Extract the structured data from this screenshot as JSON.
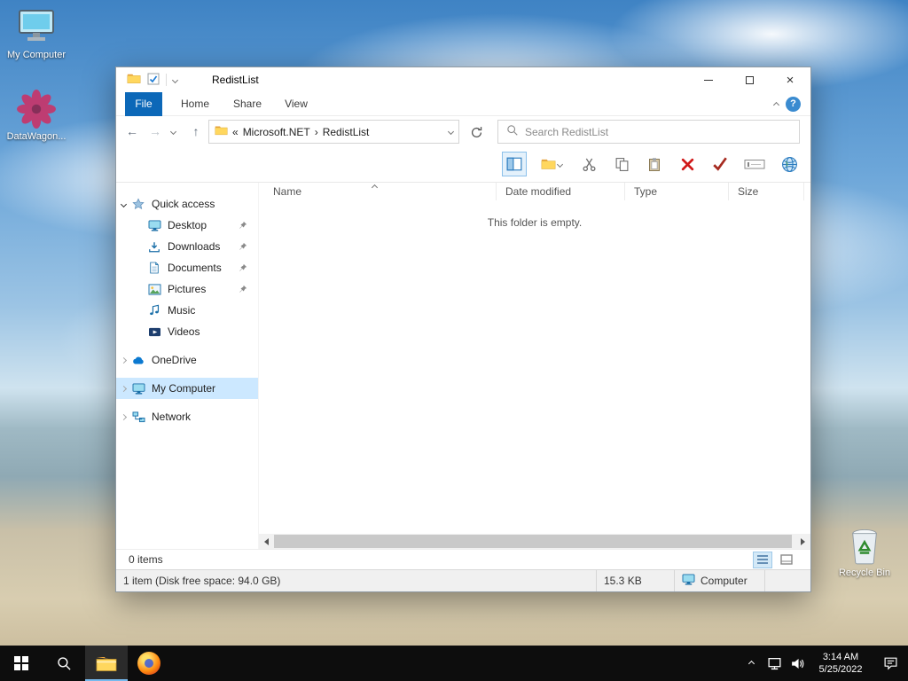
{
  "colors": {
    "accent_blue": "#0c68b8",
    "selection_blue": "#cce8ff",
    "delete_red": "#d01818",
    "taskbar_black": "#0d0d0d",
    "folder_yellow": "#ffd75e"
  },
  "desktop": {
    "my_computer_label": "My Computer",
    "datawagon_label": "DataWagon...",
    "recycle_bin_label": "Recycle Bin"
  },
  "explorer": {
    "title": "RedistList",
    "tabs": {
      "file": "File",
      "home": "Home",
      "share": "Share",
      "view": "View"
    },
    "help_label": "?",
    "nav": {
      "back": "←",
      "forward": "→",
      "up": "↑"
    },
    "address": {
      "overflow": "«",
      "crumb1": "Microsoft.NET",
      "sep1": "›",
      "crumb2": "RedistList"
    },
    "search_placeholder": "Search RedistList",
    "columns": {
      "name": "Name",
      "date_modified": "Date modified",
      "type": "Type",
      "size": "Size"
    },
    "empty_message": "This folder is empty.",
    "sidebar": {
      "quick_access": "Quick access",
      "desktop": "Desktop",
      "downloads": "Downloads",
      "documents": "Documents",
      "pictures": "Pictures",
      "music": "Music",
      "videos": "Videos",
      "onedrive": "OneDrive",
      "my_computer": "My Computer",
      "network": "Network"
    },
    "status": {
      "item_count": "0 items"
    },
    "details_bar": {
      "info": "1 item (Disk free space: 94.0 GB)",
      "size": "15.3 KB",
      "zone": "Computer"
    }
  },
  "taskbar": {
    "time": "3:14 AM",
    "date": "5/25/2022"
  },
  "window_controls": {
    "close": "×"
  }
}
